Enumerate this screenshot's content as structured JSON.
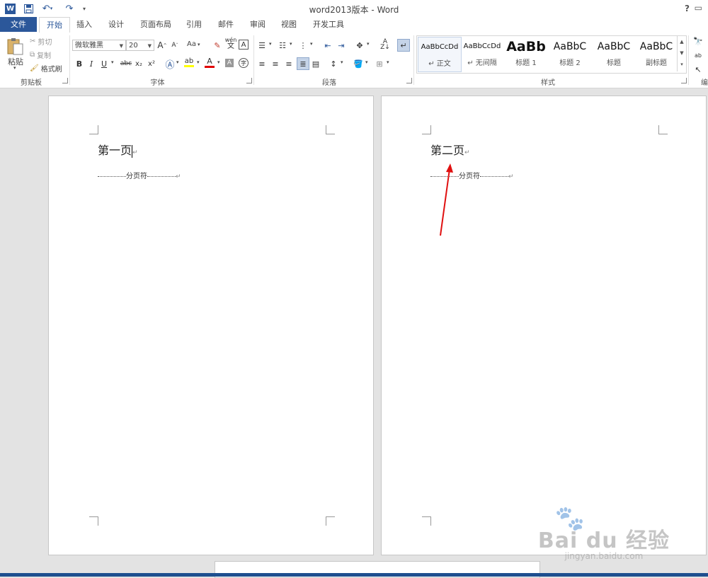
{
  "window": {
    "title": "word2013版本 - Word",
    "help": "?",
    "icon_name": "word-app-icon",
    "accent": "#2b579a"
  },
  "quick_access": {
    "save_icon": "save-icon",
    "undo_icon": "undo-icon",
    "redo_icon": "redo-icon",
    "customize_icon": "customize-dropdown-icon"
  },
  "tabs": [
    {
      "label": "文件",
      "active": false
    },
    {
      "label": "开始",
      "active": true
    },
    {
      "label": "插入"
    },
    {
      "label": "设计"
    },
    {
      "label": "页面布局"
    },
    {
      "label": "引用"
    },
    {
      "label": "邮件"
    },
    {
      "label": "审阅"
    },
    {
      "label": "视图"
    },
    {
      "label": "开发工具"
    }
  ],
  "ribbon": {
    "clipboard": {
      "label": "剪贴板",
      "paste": "粘贴",
      "cut": "剪切",
      "copy": "复制",
      "format_painter": "格式刷"
    },
    "font": {
      "label": "字体",
      "font_name": "微软雅黑",
      "font_size": "20",
      "change_case": "Aa",
      "bold": "B",
      "italic": "I",
      "underline": "U",
      "strike": "abc",
      "subscript": "x₂",
      "superscript": "x²",
      "highlight_color": "#ffff00",
      "font_color": "#e00000",
      "phonetic": "wén",
      "phonetic_char": "文",
      "grow": "A",
      "shrink": "A"
    },
    "paragraph": {
      "label": "段落"
    },
    "styles": {
      "label": "样式",
      "items": [
        {
          "preview": "AaBbCcDd",
          "name": "正文"
        },
        {
          "preview": "AaBbCcDd",
          "name": "无间隔"
        },
        {
          "preview": "AaBb",
          "name": "标题 1"
        },
        {
          "preview": "AaBbC",
          "name": "标题 2"
        },
        {
          "preview": "AaBbC",
          "name": "标题"
        },
        {
          "preview": "AaBbC",
          "name": "副标题"
        }
      ]
    },
    "editing": {
      "label": "编"
    }
  },
  "document": {
    "page1": {
      "heading": "第一页",
      "page_break_label": "分页符"
    },
    "page2": {
      "heading": "第二页",
      "page_break_label": "分页符"
    }
  },
  "annotation": {
    "arrow_color": "#e01010"
  },
  "watermark": {
    "brand": "Bai du 经验",
    "url": "jingyan.baidu.com"
  }
}
